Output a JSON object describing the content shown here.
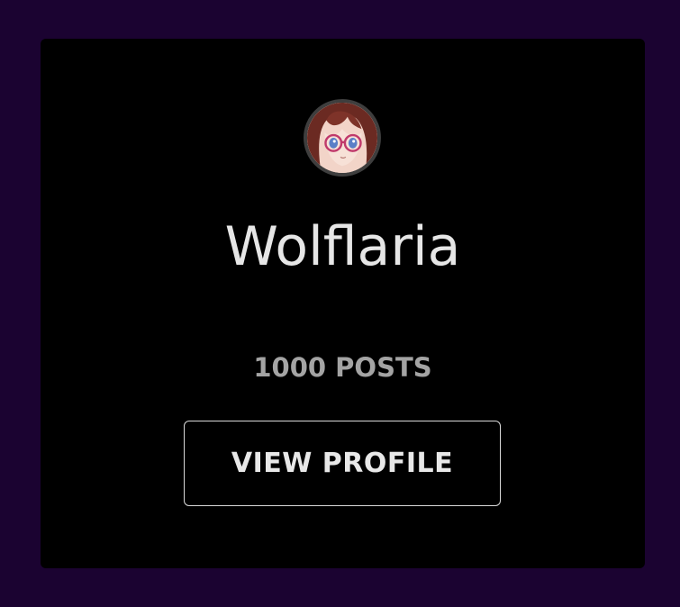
{
  "profile": {
    "name": "Wolflaria",
    "posts_label": "1000 POSTS",
    "view_profile_label": "VIEW PROFILE",
    "avatar_icon": "anime-girl-avatar-icon"
  },
  "colors": {
    "page_background": "#1b0331",
    "card_background": "#000000",
    "name_text": "#e6e6e6",
    "posts_text": "#a4a4a4",
    "button_border": "#d9d9d9"
  }
}
